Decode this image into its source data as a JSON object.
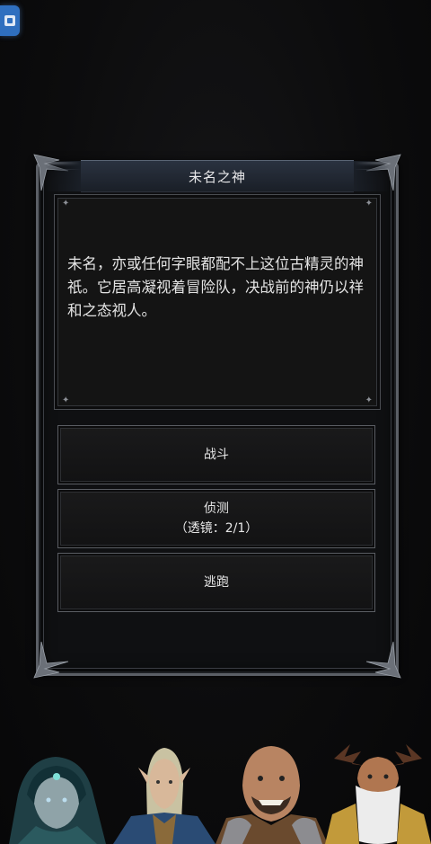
{
  "dialog": {
    "title": "未名之神",
    "description": "未名，亦或任何字眼都配不上这位古精灵的神祇。它居高凝视着冒险队，决战前的神仍以祥和之态视人。",
    "choices": [
      {
        "label": "战斗",
        "sub": ""
      },
      {
        "label": "侦测",
        "sub": "（透镜：2/1）"
      },
      {
        "label": "逃跑",
        "sub": ""
      }
    ]
  },
  "party": [
    {
      "name": "hooded-sorceress",
      "icon": "portrait-hooded-sorceress"
    },
    {
      "name": "elf-ranger",
      "icon": "portrait-elf-ranger"
    },
    {
      "name": "bald-warrior",
      "icon": "portrait-bald-warrior"
    },
    {
      "name": "antlered-druid",
      "icon": "portrait-antlered-druid"
    }
  ],
  "colors": {
    "background": "#0b0b0c",
    "frame": "#5b5f66",
    "title_bar": "#2a3240",
    "text": "#e6e6e6",
    "badge": "#2f6fbf"
  }
}
